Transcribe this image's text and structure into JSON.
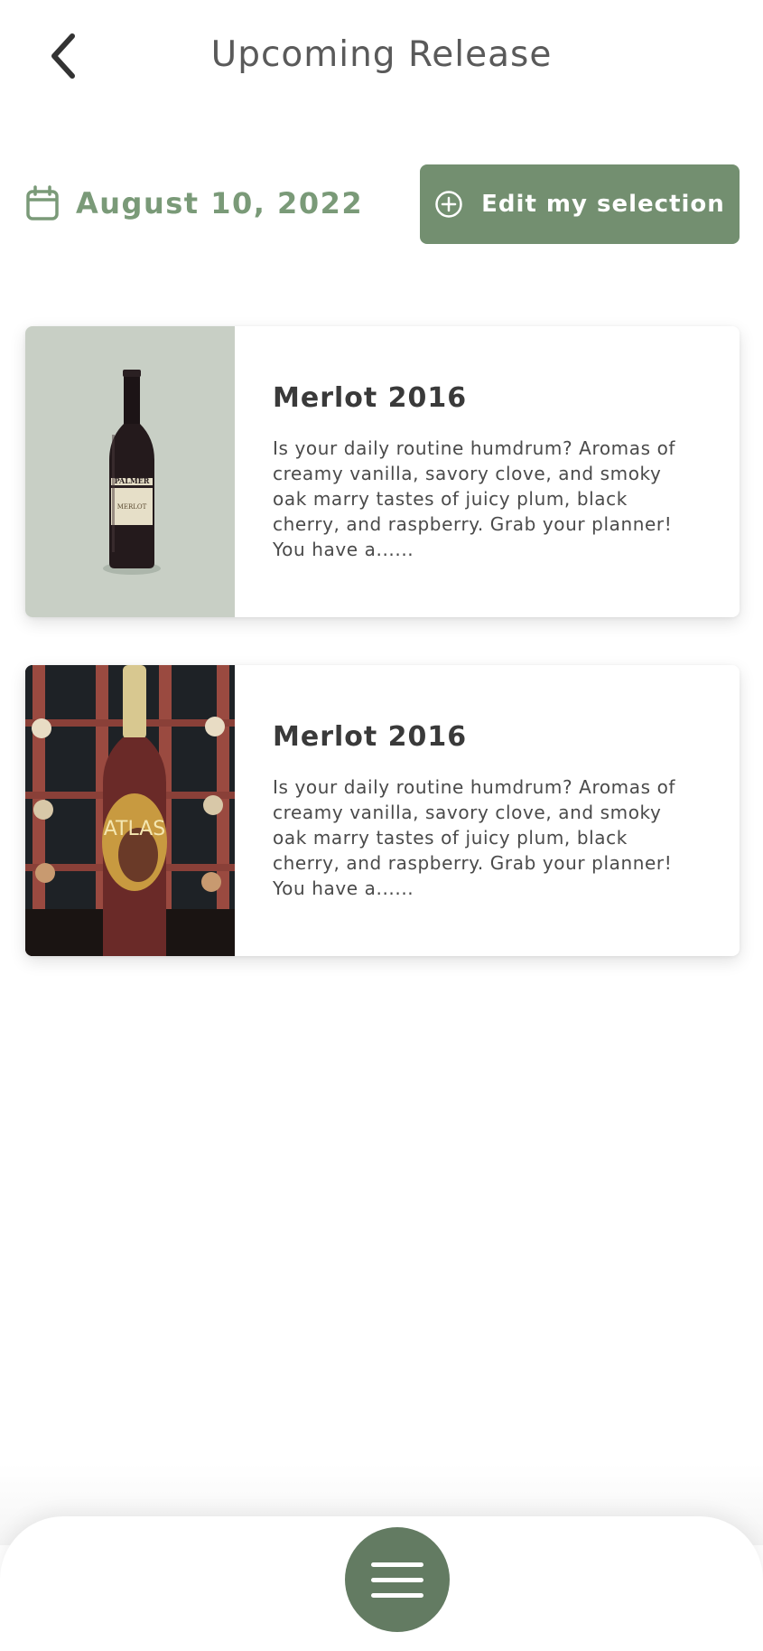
{
  "header": {
    "title": "Upcoming Release",
    "back_icon": "chevron-left-icon"
  },
  "release": {
    "calendar_icon": "calendar-icon",
    "date": "August 10, 2022"
  },
  "edit_button": {
    "icon": "plus-circle-icon",
    "label": "Edit my selection"
  },
  "wines": [
    {
      "image": "wine-bottle-photo",
      "label_text": "PALMER",
      "label_sub": "MERLOT",
      "title": "Merlot 2016",
      "description": "Is your daily routine humdrum? Aromas of creamy vanilla, savory clove, and smoky oak marry tastes of juicy plum, black cherry, and raspberry. Grab your planner! You have a......"
    },
    {
      "image": "wine-rack-photo",
      "label_text": "ATLAS",
      "title": "Merlot 2016",
      "description": "Is your daily routine humdrum? Aromas of creamy vanilla, savory clove, and smoky oak marry tastes of juicy plum, black cherry, and raspberry. Grab your planner! You have a......"
    }
  ],
  "bottom_nav": {
    "menu_icon": "hamburger-menu-icon"
  },
  "colors": {
    "accent": "#738f70",
    "accent_dark": "#637b62",
    "date_text": "#7a9a78"
  }
}
